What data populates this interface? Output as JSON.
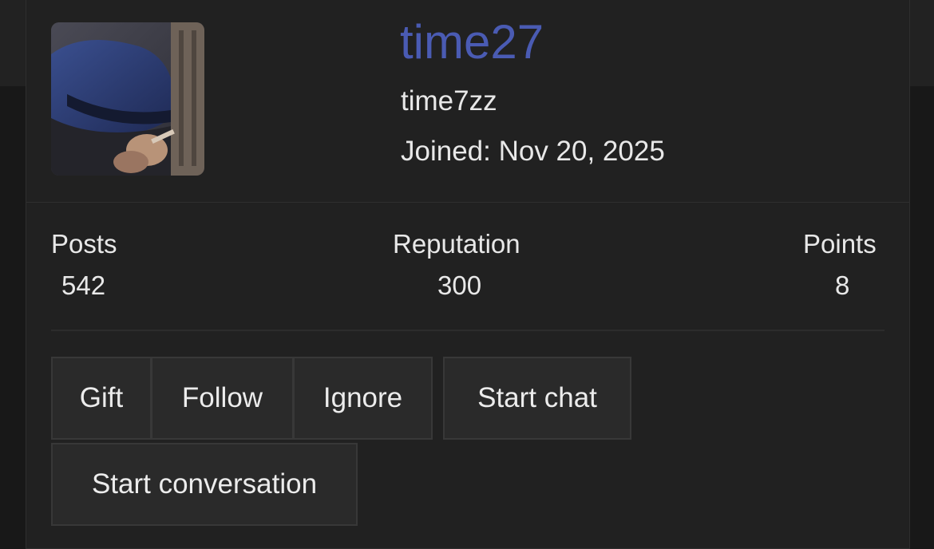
{
  "profile": {
    "display_name": "time27",
    "username": "time7zz",
    "joined": "Joined: Nov 20, 2025",
    "avatar_alt": "avatar"
  },
  "stats": {
    "posts_label": "Posts",
    "posts_value": "542",
    "reputation_label": "Reputation",
    "reputation_value": "300",
    "points_label": "Points",
    "points_value": "8"
  },
  "actions": {
    "gift": "Gift",
    "follow": "Follow",
    "ignore": "Ignore",
    "start_chat": "Start chat",
    "start_conversation": "Start conversation"
  },
  "colors": {
    "display_name": "#4a5bb3",
    "card_bg": "#212121",
    "button_bg": "#2a2a2a"
  }
}
